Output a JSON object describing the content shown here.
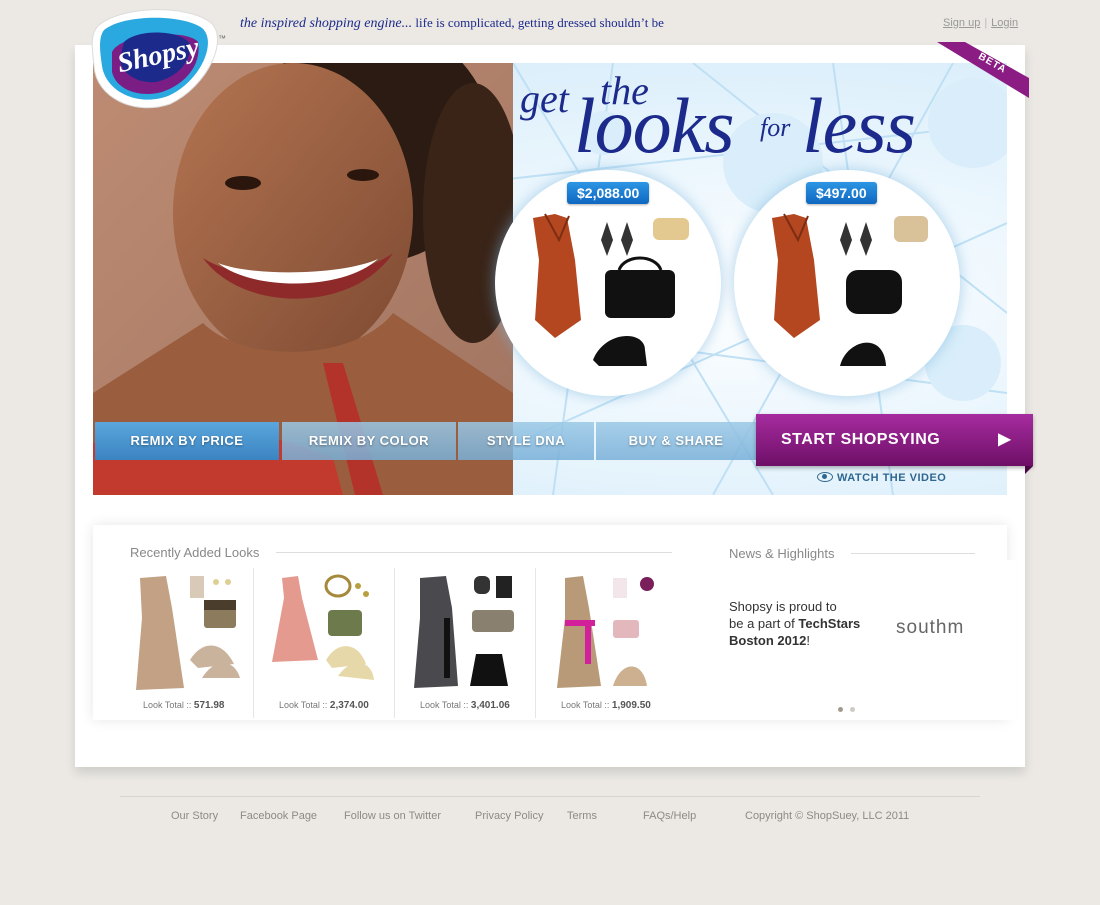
{
  "header": {
    "logo_text": "Shopsy",
    "trademark": "™",
    "tagline_em": "the inspired shopping engine...",
    "tagline_rest": "life is complicated, getting dressed shouldn’t be",
    "signup_label": "Sign up",
    "login_label": "Login",
    "separator": "|"
  },
  "hero": {
    "headline_get": "get",
    "headline_the": "the",
    "headline_looks": "looks",
    "headline_for": "for",
    "headline_less": "less",
    "price_high": "$2,088.00",
    "price_low": "$497.00",
    "beta_label": "BETA",
    "tabs": [
      {
        "label": "REMIX BY PRICE"
      },
      {
        "label": "REMIX BY COLOR"
      },
      {
        "label": "STYLE DNA"
      },
      {
        "label": "BUY & SHARE"
      }
    ],
    "start_label": "START SHOPSYING",
    "start_arrow": "▶",
    "watch_label": "WATCH THE VIDEO"
  },
  "recent": {
    "title": "Recently Added Looks",
    "total_label": "Look Total ::",
    "looks": [
      {
        "total": "571.98"
      },
      {
        "total": "2,374.00"
      },
      {
        "total": "3,401.06"
      },
      {
        "total": "1,909.50"
      }
    ]
  },
  "news": {
    "title": "News & Highlights",
    "line1": "Shopsy is proud to",
    "line2_pre": "be a part of ",
    "line2_bold": "TechStars",
    "line3_bold": "Boston 2012",
    "line3_post": "!",
    "partner_logo_text": "southm"
  },
  "footer": {
    "links": [
      "Our Story",
      "Facebook Page",
      "Follow us on Twitter",
      "Privacy Policy",
      "Terms",
      "FAQs/Help"
    ],
    "copyright": "Copyright © ShopSuey, LLC 2011"
  },
  "colors": {
    "brand_navy": "#1c2a8c",
    "brand_purple": "#8a1c84",
    "brand_blue": "#2d95e4",
    "dress_rust": "#b4471f"
  }
}
